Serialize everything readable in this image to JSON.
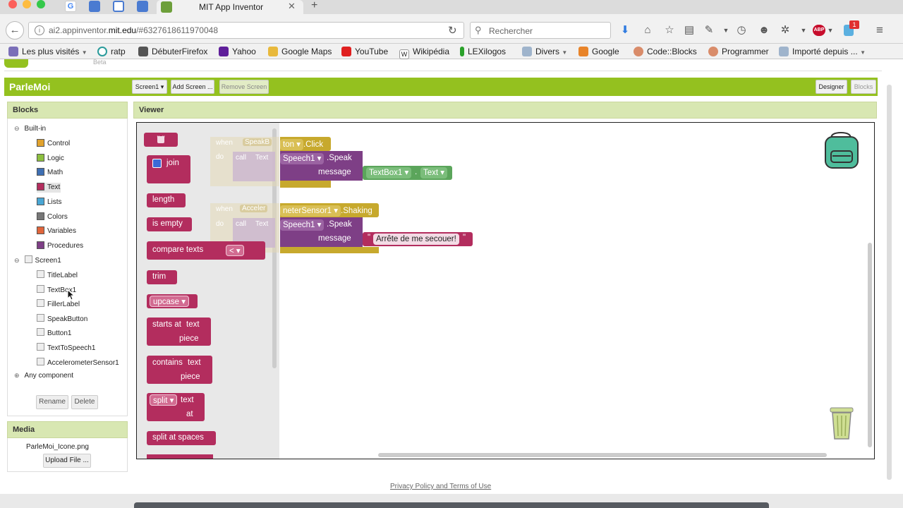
{
  "browser": {
    "tab_title": "MIT App Inventor",
    "url_prefix": "ai2.appinventor.",
    "url_domain": "mit.edu",
    "url_suffix": "/#6327618611970048",
    "search_placeholder": "Rechercher",
    "abp_label": "ABP",
    "notification_count": "1",
    "bookmarks": [
      "Les plus visités",
      "ratp",
      "DébuterFirefox",
      "Yahoo",
      "Google Maps",
      "YouTube",
      "Wikipédia",
      "LEXilogos",
      "Divers",
      "Google",
      "Code::Blocks",
      "Programmer",
      "Importé depuis ..."
    ]
  },
  "app": {
    "partial_logo_text": "Beta",
    "project_name": "ParleMoi",
    "screen_select": "Screen1 ▾",
    "add_screen": "Add Screen ...",
    "remove_screen": "Remove Screen",
    "designer": "Designer",
    "blocks": "Blocks"
  },
  "blocks_panel": {
    "title": "Blocks",
    "builtin": "Built-in",
    "builtin_items": [
      {
        "label": "Control",
        "color": "#e1a22d"
      },
      {
        "label": "Logic",
        "color": "#8cbf3f"
      },
      {
        "label": "Math",
        "color": "#3e6fb3"
      },
      {
        "label": "Text",
        "color": "#b32d5e"
      },
      {
        "label": "Lists",
        "color": "#49a6d4"
      },
      {
        "label": "Colors",
        "color": "#777777"
      },
      {
        "label": "Variables",
        "color": "#e0653b"
      },
      {
        "label": "Procedures",
        "color": "#7e3f86"
      }
    ],
    "screen": "Screen1",
    "components": [
      "TitleLabel",
      "TextBox1",
      "FillerLabel",
      "SpeakButton",
      "Button1",
      "TextToSpeech1",
      "AccelerometerSensor1"
    ],
    "any_component": "Any component",
    "rename": "Rename",
    "delete": "Delete"
  },
  "media_panel": {
    "title": "Media",
    "file": "ParleMoi_Icone.png",
    "upload": "Upload File ..."
  },
  "viewer": {
    "title": "Viewer",
    "flyout": {
      "quote": "\" \"",
      "join": "join",
      "length": "length",
      "is_empty": "is empty",
      "compare_texts": "compare texts",
      "compare_op": "<",
      "trim": "trim",
      "upcase": "upcase",
      "starts_at": "starts at",
      "contains": "contains",
      "text": "text",
      "piece": "piece",
      "split": "split",
      "at": "at",
      "split_at_spaces": "split at spaces",
      "faded_when": "when",
      "faded_do": "do",
      "faded_call": "call",
      "faded_text": "Text",
      "faded_speak": "SpeakB",
      "faded_accel": "Acceler"
    },
    "event1": {
      "component": "ton",
      "event": ".Click",
      "speech": "Speech1",
      "method": ".Speak",
      "message": "message",
      "textbox": "TextBox1",
      "prop": "Text"
    },
    "event2": {
      "component": "neterSensor1",
      "event": ".Shaking",
      "speech": "Speech1",
      "method": ".Speak",
      "message": "message",
      "string": "Arrête de me secouer!"
    }
  },
  "footer": {
    "privacy": "Privacy Policy and Terms of Use"
  }
}
